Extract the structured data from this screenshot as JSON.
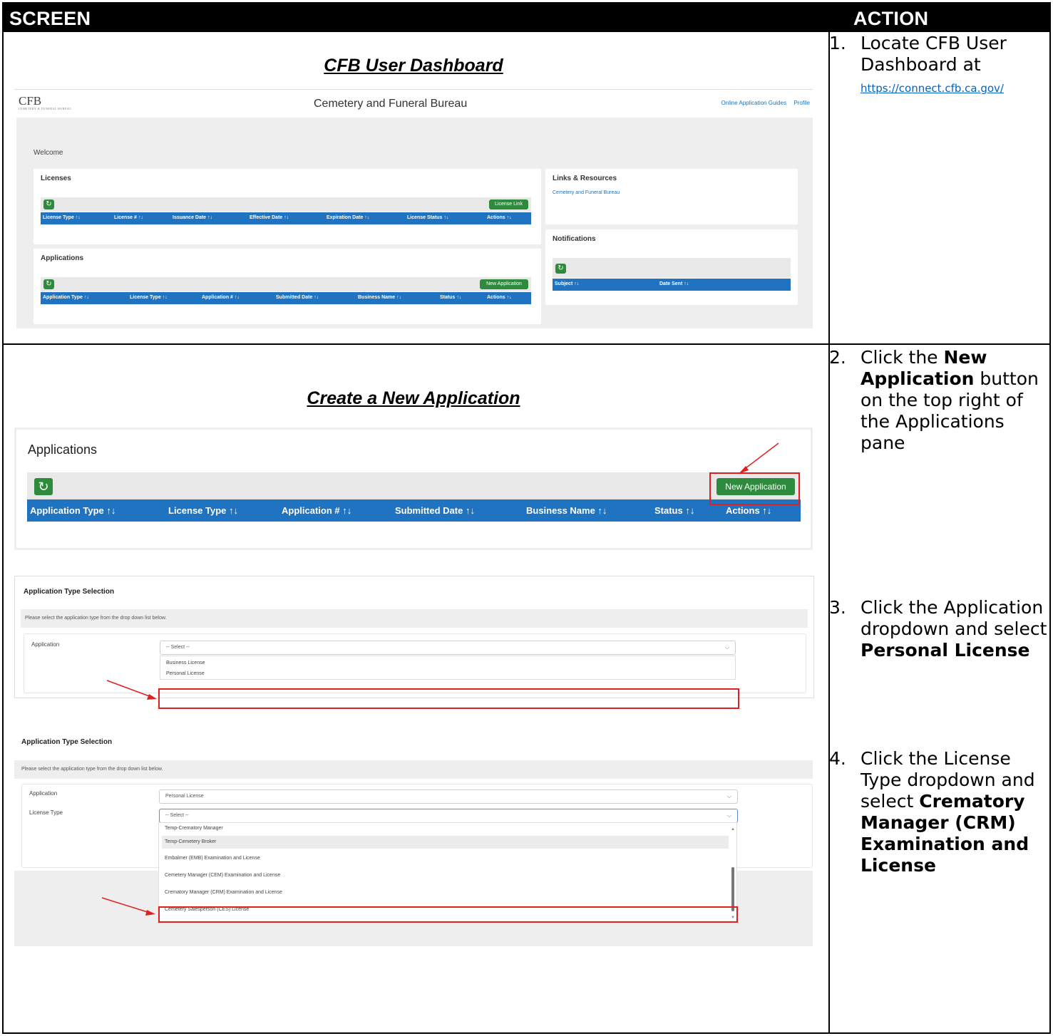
{
  "header": {
    "screen": "SCREEN",
    "action": "ACTION"
  },
  "section1": {
    "title": "CFB User Dashboard",
    "dashboard": {
      "logo": "CFB",
      "logo_sub": "CEMETERY & FUNERAL BUREAU",
      "site_title": "Cemetery and Funeral Bureau",
      "links": [
        "Online Application Guides",
        "Profile"
      ],
      "welcome": "Welcome",
      "licenses": {
        "title": "Licenses",
        "button": "License Link",
        "columns": [
          "License Type ↑↓",
          "License # ↑↓",
          "Issuance Date ↑↓",
          "Effective Date ↑↓",
          "Expiration Date ↑↓",
          "License Status ↑↓",
          "Actions ↑↓"
        ]
      },
      "applications": {
        "title": "Applications",
        "button": "New Application",
        "columns": [
          "Application Type ↑↓",
          "License Type ↑↓",
          "Application # ↑↓",
          "Submitted Date ↑↓",
          "Business Name ↑↓",
          "Status ↑↓",
          "Actions ↑↓"
        ]
      },
      "links_resources": {
        "title": "Links & Resources",
        "link": "Cemetery and Funeral Bureau"
      },
      "notifications": {
        "title": "Notifications",
        "columns": [
          "Subject ↑↓",
          "Date Sent ↑↓"
        ]
      }
    },
    "step": {
      "num": "1.",
      "text": "Locate CFB User Dashboard at",
      "url": "https://connect.cfb.ca.gov/"
    }
  },
  "section2": {
    "title": "Create a New Application",
    "apps_panel": {
      "title": "Applications",
      "button": "New Application",
      "columns": [
        "Application Type ↑↓",
        "License Type ↑↓",
        "Application # ↑↓",
        "Submitted Date ↑↓",
        "Business Name ↑↓",
        "Status ↑↓",
        "Actions ↑↓"
      ]
    },
    "sel1": {
      "title": "Application Type Selection",
      "hint": "Please select the application type from the drop down list below.",
      "label": "Application",
      "value": "-- Select --",
      "options": [
        "Business License",
        "Personal License"
      ]
    },
    "sel2": {
      "title": "Application Type Selection",
      "hint": "Please select the application type from the drop down list below.",
      "app_label": "Application",
      "app_value": "Personal License",
      "type_label": "License Type",
      "type_value": "-- Select --",
      "options": [
        "Temp-Crematory Manager",
        "Temp-Cemetery Broker",
        "Embalmer (EMB) Examination and License",
        "Cemetery Manager (CEM) Examination and License",
        "Crematory Manager (CRM) Examination and License",
        "Cemetery Salesperson (CES) License"
      ]
    },
    "step2": {
      "num": "2.",
      "pre": "Click the ",
      "bold": "New Application",
      "post": " button on the top right of the Applications pane"
    },
    "step3": {
      "num": "3.",
      "pre": "Click the Application dropdown and select ",
      "bold": "Personal License"
    },
    "step4": {
      "num": "4.",
      "pre": "Click the License Type dropdown and select ",
      "bold": "Crematory Manager (CRM) Examination and License"
    }
  },
  "colors": {
    "accent_blue": "#1f73c1",
    "button_green": "#2e8b3d",
    "highlight_red": "#e02020"
  }
}
